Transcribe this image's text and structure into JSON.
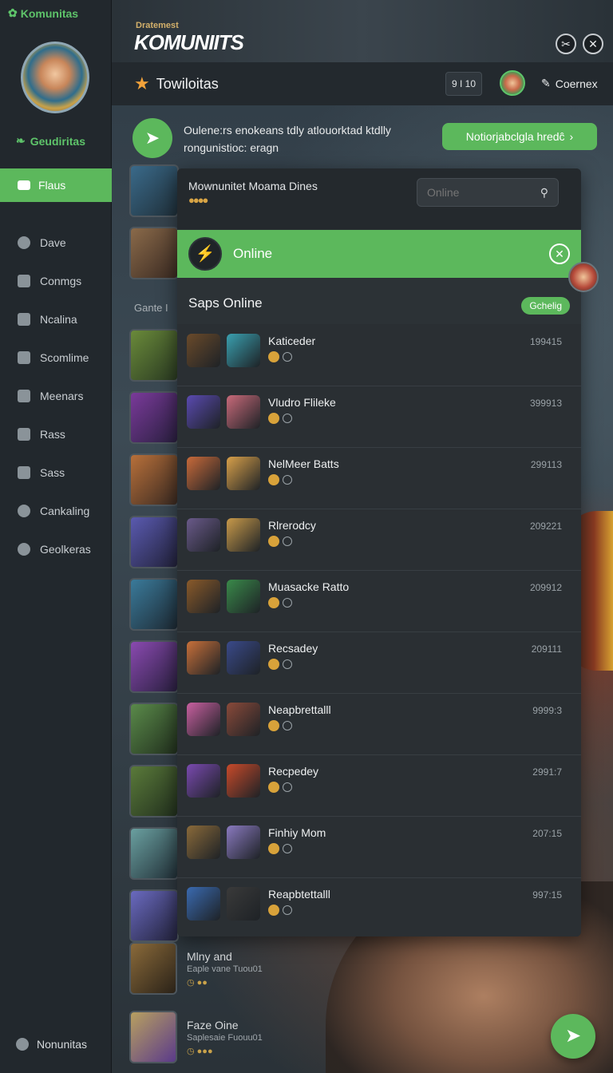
{
  "app": {
    "brand": "Komunitas",
    "banner_sub": "Dratemest",
    "banner_title": "KOMUNIITS"
  },
  "sidebar": {
    "section_label": "Geudiritas",
    "active_item": "Flaus",
    "items": [
      {
        "label": "Dave",
        "icon": "pin-icon"
      },
      {
        "label": "Conmgs",
        "icon": "chat-icon"
      },
      {
        "label": "Ncalina",
        "icon": "home-icon"
      },
      {
        "label": "Scomlime",
        "icon": "brush-icon"
      },
      {
        "label": "Meenars",
        "icon": "user-icon"
      },
      {
        "label": "Rass",
        "icon": "grid-icon"
      },
      {
        "label": "Sass",
        "icon": "folder-icon"
      },
      {
        "label": "Cankaling",
        "icon": "gear-icon"
      },
      {
        "label": "Geolkeras",
        "icon": "gear-icon"
      }
    ],
    "bottom_label": "Nonunitas"
  },
  "header": {
    "title": "Towiloitas",
    "badge": "9 I 10",
    "user": "Coernex"
  },
  "announcement": {
    "text": "Oulene:rs enokeans tdly atlouorktad ktdlly rongunistioc: eragn",
    "button": "Notiorjabclgla hredĉ"
  },
  "background_list": {
    "label": "Gante I",
    "bottom_items": [
      {
        "title": "Mlny and",
        "sub": "Eaple vane Tuou01"
      },
      {
        "title": "Faze Oine",
        "sub": "Saplesaie Fuouu01"
      }
    ]
  },
  "panel": {
    "top_title": "Mownunitet Moama Dines",
    "search_placeholder": "Online",
    "online_label": "Online",
    "section_title": "Saps Online",
    "section_pill": "Gchelig",
    "rows": [
      {
        "name": "Katiceder",
        "num": "199415"
      },
      {
        "name": "Vludro Flileke",
        "num": "399913"
      },
      {
        "name": "NelMeer Batts",
        "num": "299113"
      },
      {
        "name": "Rlrerodcy",
        "num": "209221"
      },
      {
        "name": "Muasacke Ratto",
        "num": "209912"
      },
      {
        "name": "Recsadey",
        "num": "209111"
      },
      {
        "name": "Neapbrettalll",
        "num": "9999:3"
      },
      {
        "name": "Recpedey",
        "num": "2991:7"
      },
      {
        "name": "Finhiy Mom",
        "num": "207:15"
      },
      {
        "name": "Reapbtettalll",
        "num": "997:15"
      }
    ]
  },
  "colors": {
    "accent": "#5cb85c",
    "sidebar_bg": "#22282d",
    "panel_bg": "#2a2f33"
  }
}
